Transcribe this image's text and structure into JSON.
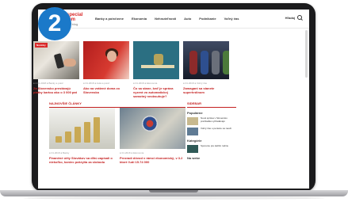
{
  "step_number": "2",
  "site": {
    "logo_line1": "special",
    "logo_line2": "tom",
    "logo_sub": "the blog",
    "nav": [
      "Banky a poisťovne",
      "Ekonomia",
      "Nehnuteľnosti",
      "Auto",
      "Podnikanie",
      "Voľný čas"
    ],
    "nav_right": "Hľadaj"
  },
  "top_cards": [
    {
      "tag": "Novinky",
      "meta": "● 2 01.2018  ● Banky a poisť",
      "title": "Za Slovensko prestávajú platby kartou ako o 3 000 pat"
    },
    {
      "tag": "",
      "meta": "● 01.2018  ● Autá a poisť",
      "title": "Ako na vrátené doma zo Slovenska"
    },
    {
      "tag": "",
      "meta": "● 01.2018  ● Ekonomia",
      "title": "Čo sa stane, keď je správa vyzerá vo automatickej samotný neobsuhuje?"
    },
    {
      "tag": "",
      "meta": "● 01.2018  ● Voľný čas",
      "title": "Zamagani sa stanete superhrdinom"
    }
  ],
  "section_main": "NAJNOVŠIE ČLÁNKY",
  "section_side": "SIDEBAR",
  "bottom_cards": [
    {
      "meta": "● 01.2018  ● Banky",
      "title": "Finančné účty Slovákov sa dlhú zapísali o niekoľko, koniec pokrytia za slobodu"
    },
    {
      "meta": "● 01.2018  ● Ekonomia",
      "title": "Prezradí dôvod v rámci ekonomický, v 3.2 ktoré ľudí 15.74 000"
    }
  ],
  "sidebar": {
    "title1": "Populárne",
    "items": [
      {
        "text": "Nová správa v Slovensku prehliadka vyhľadávajú"
      },
      {
        "text": "Voľný čas o peniaze sa naučí"
      }
    ],
    "title2": "Kategórie",
    "item3": "Sporenie pre každú rodinu",
    "title3": "Na webe"
  },
  "colors": {
    "accent": "#c42020",
    "badge": "#1b79c9",
    "laptop": "#1b1b1d"
  }
}
